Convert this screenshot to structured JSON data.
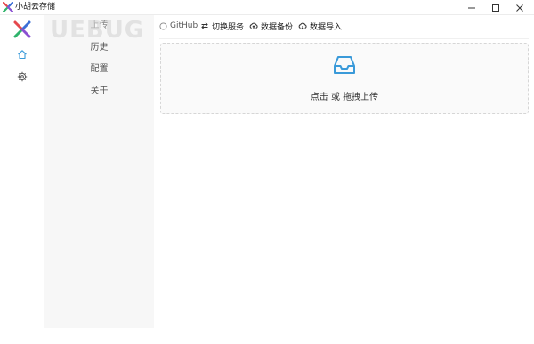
{
  "window": {
    "title": "小胡云存储",
    "controls": [
      "minimize",
      "maximize",
      "close"
    ]
  },
  "watermark": {
    "text": "UEBUG"
  },
  "rail": {
    "logo": "x-logo",
    "items": [
      {
        "icon": "home-icon",
        "active": true
      },
      {
        "icon": "gear-icon",
        "active": false
      }
    ]
  },
  "menu": {
    "items": [
      {
        "label": "上传"
      },
      {
        "label": "历史"
      },
      {
        "label": "配置"
      },
      {
        "label": "关于"
      }
    ]
  },
  "toolbar": {
    "items": [
      {
        "label": "GitHub",
        "icon": "github-icon"
      },
      {
        "label": "切换服务",
        "icon": "switch-icon"
      },
      {
        "label": "数据备份",
        "icon": "cloud-icon"
      },
      {
        "label": "数据导入",
        "icon": "cloud-icon"
      }
    ]
  },
  "upload": {
    "text": "点击 或 拖拽上传",
    "icon": "inbox-icon"
  },
  "colors": {
    "accent": "#3a9ad9",
    "menu_bg": "#f7f7f7",
    "logo_red": "#e5484d",
    "logo_green": "#2fb36b",
    "logo_blue": "#3b6fd6",
    "logo_purple": "#8a4fd1"
  }
}
